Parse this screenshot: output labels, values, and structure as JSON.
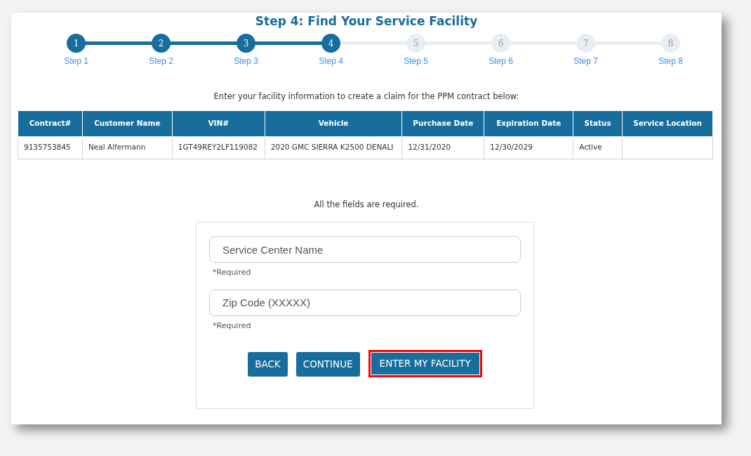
{
  "title": "Step 4: Find Your Service Facility",
  "steps": [
    {
      "number": "1",
      "label": "Step 1",
      "completed": true
    },
    {
      "number": "2",
      "label": "Step 2",
      "completed": true
    },
    {
      "number": "3",
      "label": "Step 3",
      "completed": true
    },
    {
      "number": "4",
      "label": "Step 4",
      "completed": true
    },
    {
      "number": "5",
      "label": "Step 5",
      "completed": false
    },
    {
      "number": "6",
      "label": "Step 6",
      "completed": false
    },
    {
      "number": "7",
      "label": "Step 7",
      "completed": false
    },
    {
      "number": "8",
      "label": "Step 8",
      "completed": false
    }
  ],
  "intro": "Enter your facility information to create a claim for the PPM contract below:",
  "table": {
    "columns": [
      "Contract#",
      "Customer Name",
      "VIN#",
      "Vehicle",
      "Purchase Date",
      "Expiration Date",
      "Status",
      "Service Location"
    ],
    "rows": [
      [
        "9135753845",
        "Neal Alfermann",
        "1GT49REY2LF119082",
        "2020 GMC SIERRA K2500 DENALI",
        "12/31/2020",
        "12/30/2029",
        "Active",
        ""
      ]
    ]
  },
  "form_note": "All the fields are required.",
  "fields": [
    {
      "placeholder": "Service Center Name",
      "hint": "*Required"
    },
    {
      "placeholder": "Zip Code (XXXXX)",
      "hint": "*Required"
    }
  ],
  "buttons": [
    {
      "label": "BACK",
      "highlighted": false
    },
    {
      "label": "CONTINUE",
      "highlighted": false
    },
    {
      "label": "ENTER MY FACILITY",
      "highlighted": true
    }
  ]
}
